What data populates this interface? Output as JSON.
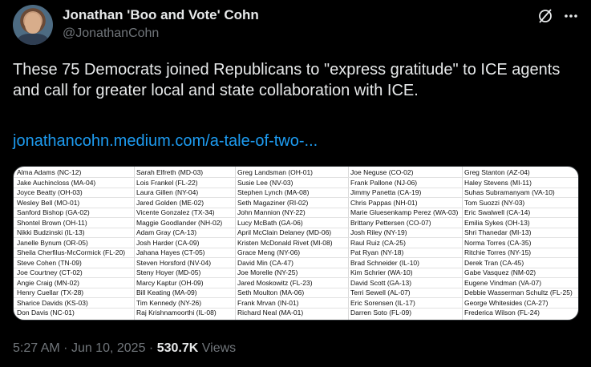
{
  "author": {
    "name": "Jonathan 'Boo and Vote' Cohn",
    "handle": "@JonathanCohn"
  },
  "icons": {
    "grok": "grok-icon",
    "more": "more-icon",
    "avatar": "avatar"
  },
  "tweet": {
    "text": "These 75 Democrats joined Republicans to \"express gratitude\" to ICE agents and call for greater local and state collaboration with ICE.",
    "link": "jonathancohn.medium.com/a-tale-of-two-..."
  },
  "media_table": {
    "columns": [
      [
        "Alma Adams (NC-12)",
        "Jake Auchincloss (MA-04)",
        "Joyce Beatty (OH-03)",
        "Wesley Bell (MO-01)",
        "Sanford Bishop (GA-02)",
        "Shontel Brown (OH-11)",
        "Nikki Budzinski (IL-13)",
        "Janelle Bynum (OR-05)",
        "Sheila Cherfilus-McCormick (FL-20)",
        "Steve Cohen (TN-09)",
        "Joe Courtney (CT-02)",
        "Angie Craig (MN-02)",
        "Henry Cuellar (TX-28)",
        "Sharice Davids (KS-03)",
        "Don Davis (NC-01)"
      ],
      [
        "Sarah Elfreth (MD-03)",
        "Lois Frankel (FL-22)",
        "Laura Gillen (NY-04)",
        "Jared Golden (ME-02)",
        "Vicente Gonzalez (TX-34)",
        "Maggie Goodlander (NH-02)",
        "Adam Gray (CA-13)",
        "Josh Harder (CA-09)",
        "Jahana Hayes (CT-05)",
        "Steven Horsford (NV-04)",
        "Steny Hoyer (MD-05)",
        "Marcy Kaptur (OH-09)",
        "Bill Keating (MA-09)",
        "Tim Kennedy (NY-26)",
        "Raj Krishnamoorthi (IL-08)"
      ],
      [
        "Greg Landsman (OH-01)",
        "Susie Lee (NV-03)",
        "Stephen Lynch (MA-08)",
        "Seth Magaziner (RI-02)",
        "John Mannion (NY-22)",
        "Lucy McBath (GA-06)",
        "April McClain Delaney (MD-06)",
        "Kristen McDonald Rivet (MI-08)",
        "Grace Meng (NY-06)",
        "David Min (CA-47)",
        "Joe Morelle (NY-25)",
        "Jared Moskowitz (FL-23)",
        "Seth Moulton (MA-06)",
        "Frank Mrvan (IN-01)",
        "Richard Neal (MA-01)"
      ],
      [
        "Joe Neguse (CO-02)",
        "Frank Pallone (NJ-06)",
        "Jimmy Panetta (CA-19)",
        "Chris Pappas (NH-01)",
        "Marie Gluesenkamp Perez (WA-03)",
        "Brittany Pettersen (CO-07)",
        "Josh Riley (NY-19)",
        "Raul Ruiz (CA-25)",
        "Pat Ryan (NY-18)",
        "Brad Schneider (IL-10)",
        "Kim Schrier (WA-10)",
        "David Scott (GA-13)",
        "Terri Sewell (AL-07)",
        "Eric Sorensen (IL-17)",
        "Darren Soto (FL-09)"
      ],
      [
        "Greg Stanton (AZ-04)",
        "Haley Stevens (MI-11)",
        "Suhas Subramanyam (VA-10)",
        "Tom Suozzi (NY-03)",
        "Eric Swalwell (CA-14)",
        "Emilia Sykes (OH-13)",
        "Shri Thanedar (MI-13)",
        "Norma Torres (CA-35)",
        "Ritchie Torres (NY-15)",
        "Derek Tran (CA-45)",
        "Gabe Vasquez (NM-02)",
        "Eugene Vindman (VA-07)",
        "Debbie Wasserman Schultz (FL-25)",
        "George Whitesides (CA-27)",
        "Frederica Wilson (FL-24)"
      ]
    ]
  },
  "meta": {
    "time": "5:27 AM",
    "sep1": "·",
    "date": "Jun 10, 2025",
    "sep2": "·",
    "views_count": "530.7K",
    "views_label": "Views"
  }
}
